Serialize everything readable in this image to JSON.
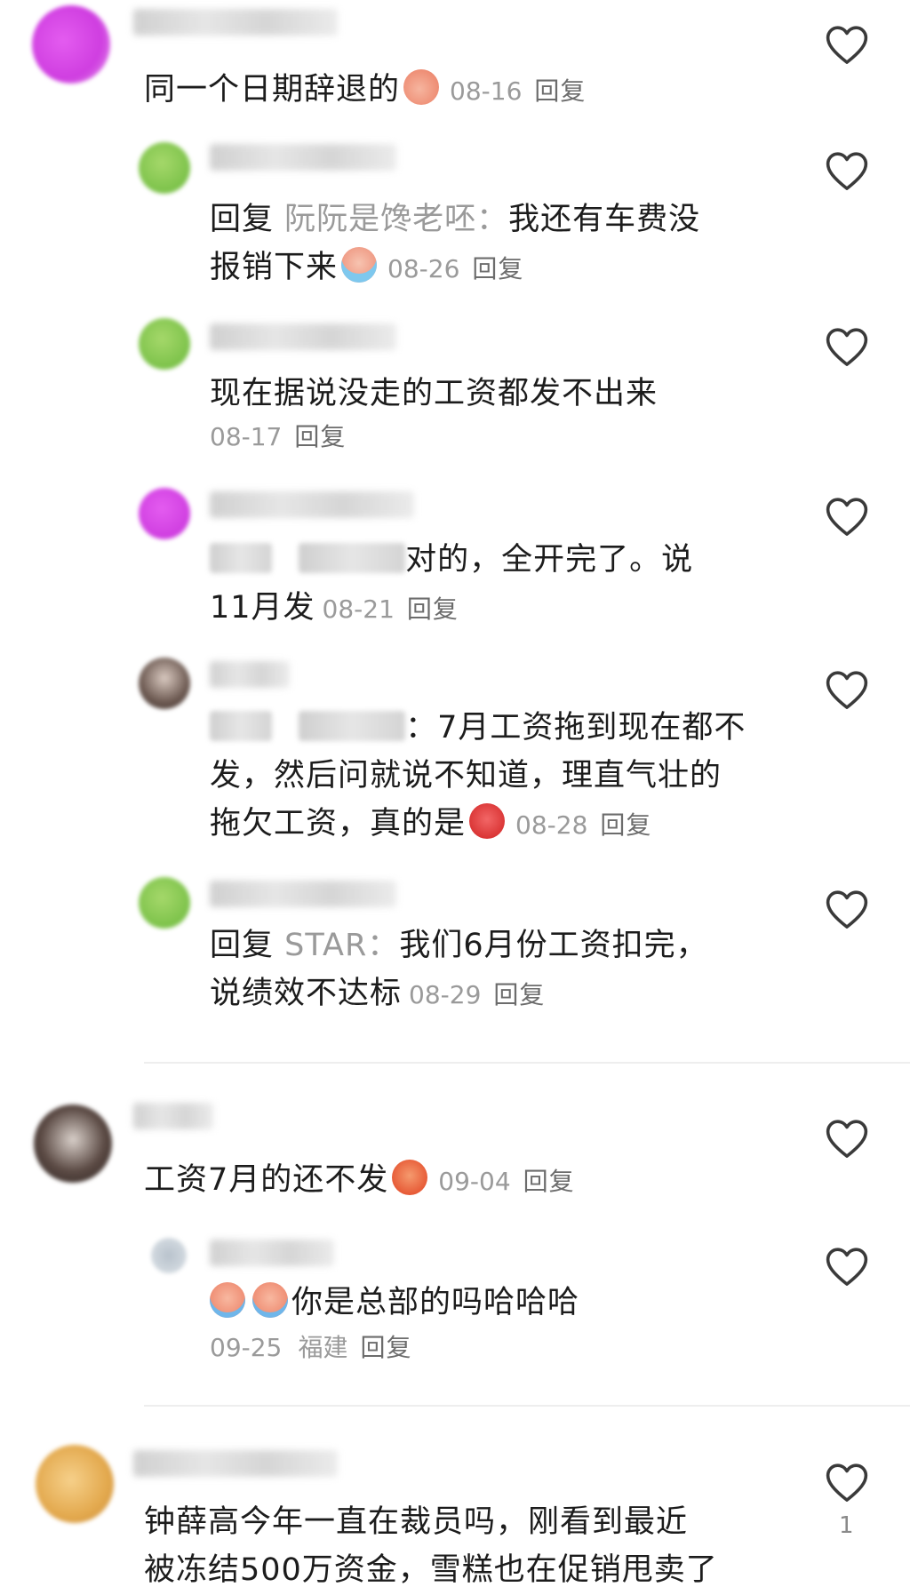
{
  "reply_label": "回复",
  "comments": [
    {
      "text": "同一个日期辞退的",
      "emoji": "peach-face-emoji",
      "date": "08-16",
      "reply": "回复"
    },
    {
      "reply_prefix": "回复",
      "reply_target": "阮阮是馋老呸：",
      "text_line1": "我还有车费没",
      "text_line2": "报销下来",
      "emoji": "crying-face-emoji",
      "date": "08-26",
      "reply": "回复"
    },
    {
      "text": "现在据说没走的工资都发不出来",
      "date": "08-17",
      "reply": "回复"
    },
    {
      "text_line1": "对的，全开完了。说",
      "text_line2": "11月发",
      "date": "08-21",
      "reply": "回复"
    },
    {
      "text_line1": "：7月工资拖到现在都不",
      "text_line2": "发，然后问就说不知道，理直气壮的",
      "text_line3": "拖欠工资，真的是",
      "emoji": "angry-cursing-emoji",
      "date": "08-28",
      "reply": "回复"
    },
    {
      "reply_prefix": "回复",
      "reply_target": "STAR：",
      "text_line1": "我们6月份工资扣完，",
      "text_line2": "说绩效不达标",
      "date": "08-29",
      "reply": "回复"
    },
    {
      "text": "工资7月的还不发",
      "emoji": "angry-face-emoji",
      "date": "09-04",
      "reply": "回复"
    },
    {
      "text": "你是总部的吗哈哈哈",
      "emojis": [
        "sobbing-face-emoji",
        "sobbing-face-emoji"
      ],
      "date": "09-25",
      "location": "福建",
      "reply": "回复"
    },
    {
      "text_line1": "钟薛高今年一直在裁员吗，刚看到最近",
      "text_line2": "被冻结500万资金，雪糕也在促销甩卖了",
      "like_count": "1"
    }
  ],
  "colors": {
    "text": "#1c1c1c",
    "meta": "#9a9a9a",
    "heart_stroke": "#3a3a3a",
    "divider": "#eeeeee"
  }
}
